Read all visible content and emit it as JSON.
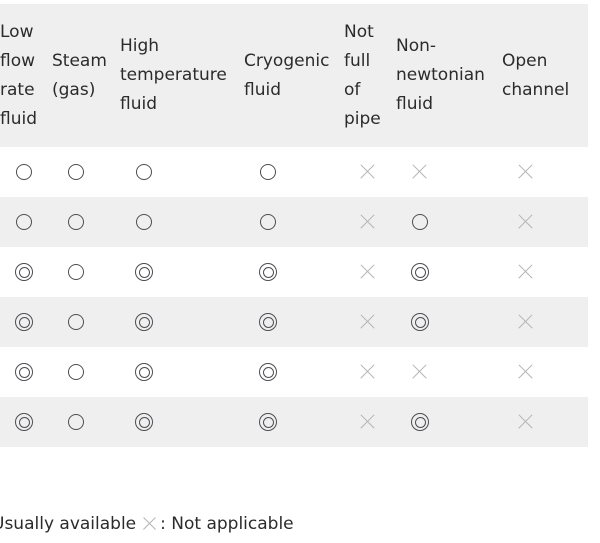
{
  "table": {
    "columns": [
      "Low flow rate fluid",
      "Steam (gas)",
      "High temperature fluid",
      "Cryogenic fluid",
      "Not full of pipe",
      "Non-newtonian fluid",
      "Open channel"
    ],
    "symbol_names": {
      "circle": "circle-icon",
      "dcircle": "double-circle-icon",
      "cross": "cross-icon"
    },
    "rows": [
      [
        "circle",
        "circle",
        "circle",
        "circle",
        "cross",
        "cross",
        "cross"
      ],
      [
        "circle",
        "circle",
        "circle",
        "circle",
        "cross",
        "circle",
        "cross"
      ],
      [
        "dcircle",
        "circle",
        "dcircle",
        "dcircle",
        "cross",
        "dcircle",
        "cross"
      ],
      [
        "dcircle",
        "circle",
        "dcircle",
        "dcircle",
        "cross",
        "dcircle",
        "cross"
      ],
      [
        "dcircle",
        "circle",
        "dcircle",
        "dcircle",
        "cross",
        "cross",
        "cross"
      ],
      [
        "dcircle",
        "circle",
        "dcircle",
        "dcircle",
        "cross",
        "dcircle",
        "cross"
      ]
    ]
  },
  "legend": {
    "available_label": "Usually available",
    "not_applicable_label": ": Not applicable"
  },
  "colors": {
    "header_background": "#efefef",
    "stripe_background": "#efefef",
    "row_background": "#ffffff",
    "text": "#2b2b2b",
    "symbol_stroke": "#4d4d52",
    "cross_stroke": "#b4b4b6"
  }
}
